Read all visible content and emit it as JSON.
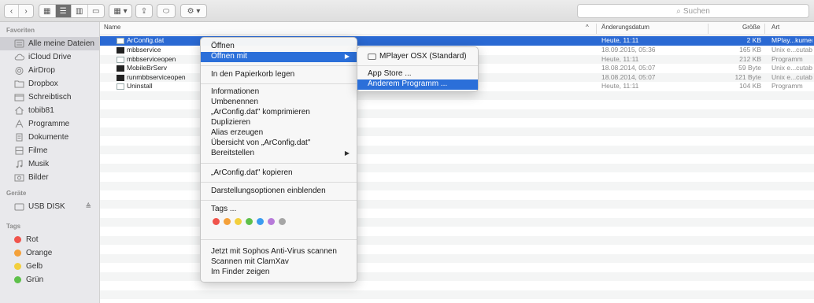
{
  "toolbar": {
    "nav_back": "‹",
    "nav_forward": "›",
    "view_icon": "▦",
    "view_list": "☰",
    "view_columns": "▥",
    "view_cover": "▭",
    "arrange": "▦ ▾",
    "share": "⇪",
    "tag": "⬭",
    "action": "⚙ ▾",
    "search_placeholder": "Suchen"
  },
  "sidebar": {
    "favorites_heading": "Favoriten",
    "favorites": [
      {
        "label": "Alle meine Dateien",
        "icon": "all-files-icon"
      },
      {
        "label": "iCloud Drive",
        "icon": "cloud-icon"
      },
      {
        "label": "AirDrop",
        "icon": "airdrop-icon"
      },
      {
        "label": "Dropbox",
        "icon": "folder-icon"
      },
      {
        "label": "Schreibtisch",
        "icon": "desktop-icon"
      },
      {
        "label": "tobib81",
        "icon": "home-icon"
      },
      {
        "label": "Programme",
        "icon": "applications-icon"
      },
      {
        "label": "Dokumente",
        "icon": "documents-icon"
      },
      {
        "label": "Filme",
        "icon": "movies-icon"
      },
      {
        "label": "Musik",
        "icon": "music-icon"
      },
      {
        "label": "Bilder",
        "icon": "pictures-icon"
      }
    ],
    "devices_heading": "Geräte",
    "devices": [
      {
        "label": "USB DISK",
        "icon": "disk-icon",
        "eject": "≜"
      }
    ],
    "tags_heading": "Tags",
    "tags": [
      {
        "label": "Rot",
        "color": "#f0544c"
      },
      {
        "label": "Orange",
        "color": "#f4a13a"
      },
      {
        "label": "Gelb",
        "color": "#f2cf3d"
      },
      {
        "label": "Grün",
        "color": "#5ec04a"
      }
    ]
  },
  "columns": {
    "name": "Name",
    "sort": "^",
    "date": "Änderungsdatum",
    "size": "Größe",
    "kind": "Art"
  },
  "files": [
    {
      "name": "ArConfig.dat",
      "date": "Heute, 11:11",
      "size": "2 KB",
      "kind": "MPlay...kument",
      "icon": "document-icon",
      "selected": true
    },
    {
      "name": "mbbservice",
      "date": "18.09.2015, 05:36",
      "size": "165 KB",
      "kind": "Unix e...cutable",
      "icon": "terminal-icon"
    },
    {
      "name": "mbbserviceopen",
      "date": "Heute, 11:11",
      "size": "212 KB",
      "kind": "Programm",
      "icon": "application-icon"
    },
    {
      "name": "MobileBrServ",
      "date": "18.08.2014, 05:07",
      "size": "59 Byte",
      "kind": "Unix e...cutable",
      "icon": "terminal-icon"
    },
    {
      "name": "runmbbserviceopen",
      "date": "18.08.2014, 05:07",
      "size": "121 Byte",
      "kind": "Unix e...cutable",
      "icon": "terminal-icon"
    },
    {
      "name": "Uninstall",
      "date": "Heute, 11:11",
      "size": "104 KB",
      "kind": "Programm",
      "icon": "uninstall-icon"
    }
  ],
  "context_menu": {
    "items": [
      "Öffnen",
      "Öffnen mit",
      "In den Papierkorb legen",
      "Informationen",
      "Umbenennen",
      "„ArConfig.dat\" komprimieren",
      "Duplizieren",
      "Alias erzeugen",
      "Übersicht von „ArConfig.dat\"",
      "Bereitstellen",
      "„ArConfig.dat\" kopieren",
      "Darstellungsoptionen einblenden",
      "Tags ...",
      "Jetzt mit Sophos Anti-Virus scannen",
      "Scannen mit ClamXav",
      "Im Finder zeigen"
    ],
    "submenu_arrow": "▶",
    "tag_colors": [
      "#f0544c",
      "#f4a13a",
      "#f2cf3d",
      "#5ec04a",
      "#3b9cf0",
      "#b77ad9",
      "#a6a6a6"
    ]
  },
  "submenu": {
    "items": [
      "MPlayer OSX (Standard)",
      "App Store ...",
      "Anderem Programm ..."
    ]
  }
}
